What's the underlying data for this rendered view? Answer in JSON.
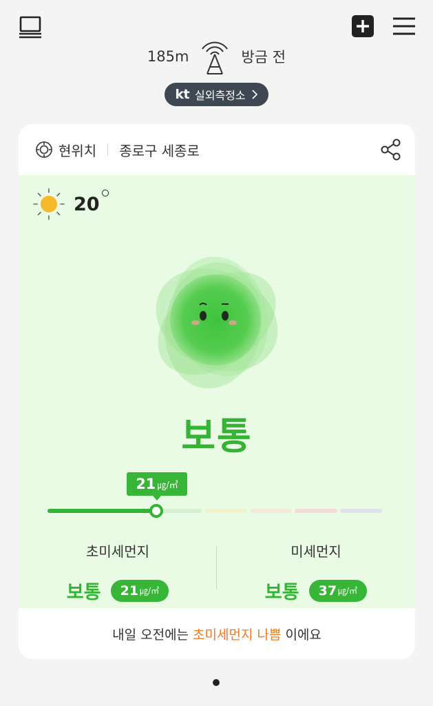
{
  "header": {
    "laptop_icon": "laptop-icon",
    "add_icon": "plus-square-icon",
    "menu_icon": "hamburger-menu-icon",
    "station_distance": "185m",
    "station_icon": "antenna-tower-icon",
    "station_updated": "방금 전",
    "provider_pill": {
      "brand": "kt",
      "label": "실외측정소",
      "icon": "chevron-right-icon"
    }
  },
  "location": {
    "icon": "target-icon",
    "label": "현위치",
    "address": "종로구 세종로",
    "share_icon": "share-icon"
  },
  "weather": {
    "icon": "sun-icon",
    "temperature": "20"
  },
  "air_quality": {
    "status": "보통",
    "current_value": "21",
    "unit": "㎍/㎥",
    "level_fraction": 0.32,
    "colors": {
      "good": "#33b533",
      "scale": [
        "#33b533",
        "#d6f0cf",
        "#eff3cf",
        "#f3ead6",
        "#f3dcd8",
        "#dde2ec"
      ]
    }
  },
  "pm25": {
    "title": "초미세먼지",
    "grade": "보통",
    "value": "21",
    "unit": "㎍/㎥"
  },
  "pm10": {
    "title": "미세먼지",
    "grade": "보통",
    "value": "37",
    "unit": "㎍/㎥"
  },
  "forecast": {
    "prefix": "내일 오전에는",
    "highlight": "초미세먼지 나쁨",
    "suffix": "이에요",
    "highlight_color": "#f07a22"
  },
  "pager": {
    "pages": 1,
    "current": 1
  }
}
